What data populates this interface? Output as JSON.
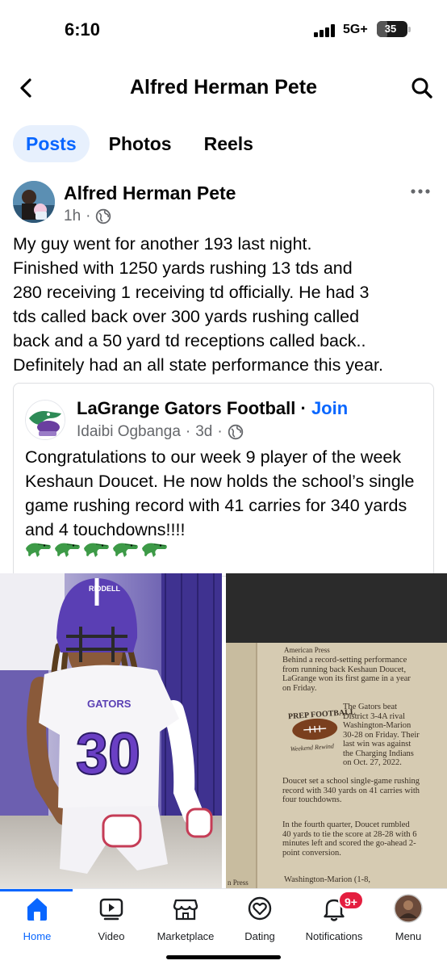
{
  "status_bar": {
    "time": "6:10",
    "network": "5G+",
    "battery": "35",
    "battery_level_percent": 35
  },
  "header": {
    "title": "Alfred Herman Pete",
    "back_icon": "chevron-left-icon",
    "search_icon": "search-icon"
  },
  "tabs": [
    {
      "label": "Posts",
      "active": true
    },
    {
      "label": "Photos",
      "active": false
    },
    {
      "label": "Reels",
      "active": false
    }
  ],
  "post": {
    "author": "Alfred Herman Pete",
    "time": "1h",
    "separator": "·",
    "privacy_icon": "globe-icon",
    "text": "My guy went for another 193 last night.\nFinished with 1250 yards rushing 13  tds and\n280 receiving  1 receiving td officially.  He had 3\ntds called back over 300 yards rushing called\nback and a 50 yard td receptions called back..\nDefinitely had an all state performance this year.",
    "shared": {
      "page_name": "LaGrange Gators Football",
      "separator": " · ",
      "join_label": "Join",
      "author": "Idaibi Ogbanga",
      "time": "3d",
      "text": "Congratulations to our week 9 player of the\nweek Keshaun Doucet. He now holds the\nschool’s single game rushing record with 41\ncarries for 340 yards and 4 touchdowns!!!!",
      "emoji": [
        "🐊",
        "🐊",
        "🐊",
        "🐊",
        "🐊"
      ]
    },
    "photo_left": {
      "helmet_text": "RIDDELL",
      "jersey_team": "GATORS",
      "jersey_number": "30"
    },
    "photo_right": {
      "source": "American Press",
      "paragraph1": "Behind a record-setting performance from running back Keshaun Doucet, LaGrange won its first game in a year on Friday.",
      "football_header": "PREP FOOTBALL",
      "football_sub": "Weekend Rewind",
      "paragraph2": "The Gators beat District 3-4A rival Washington-Marion 30-28 on Friday. Their last win was against the Charging Indians on Oct. 27, 2022.",
      "paragraph3": "Doucet set a school single-game rushing record with 340 yards on 41 carries with four touchdowns.",
      "paragraph4": "In the fourth quarter, Doucet rumbled 40 yards to tie the score at 28-28 with 6 minutes left and scored the go-ahead 2-point conversion.",
      "paragraph5": "Washington-Marion (1-8,",
      "footer": "n Press"
    }
  },
  "bottom_nav": [
    {
      "label": "Home",
      "icon": "home-icon",
      "active": true
    },
    {
      "label": "Video",
      "icon": "video-icon",
      "active": false
    },
    {
      "label": "Marketplace",
      "icon": "marketplace-icon",
      "active": false
    },
    {
      "label": "Dating",
      "icon": "dating-icon",
      "active": false
    },
    {
      "label": "Notifications",
      "icon": "bell-icon",
      "active": false,
      "badge": "9+"
    },
    {
      "label": "Menu",
      "icon": "profile-avatar-icon",
      "active": false
    }
  ],
  "colors": {
    "accent": "#0866ff",
    "tab_active_bg": "#e7f0fd",
    "badge": "#e41e3f",
    "secondary_text": "#65676b"
  }
}
